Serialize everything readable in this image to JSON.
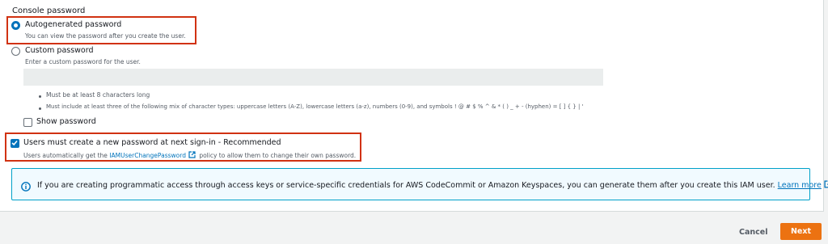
{
  "console_password": {
    "section_label": "Console password",
    "autogenerated": {
      "label": "Autogenerated password",
      "description": "You can view the password after you create the user.",
      "selected": true
    },
    "custom": {
      "label": "Custom password",
      "description": "Enter a custom password for the user.",
      "input_value": "",
      "rules": [
        "Must be at least 8 characters long",
        "Must include at least three of the following mix of character types: uppercase letters (A-Z), lowercase letters (a-z), numbers (0-9), and symbols ! @ # $ % ^ & * ( ) _ + - (hyphen) = [ ] { } | '"
      ]
    },
    "show_password": {
      "label": "Show password",
      "checked": false
    },
    "require_reset": {
      "label": "Users must create a new password at next sign-in - Recommended",
      "description_prefix": "Users automatically get the ",
      "policy_link": "IAMUserChangePassword",
      "description_suffix": " policy to allow them to change their own password.",
      "checked": true
    }
  },
  "info": {
    "text": "If you are creating programmatic access through access keys or service-specific credentials for AWS CodeCommit or Amazon Keyspaces, you can generate them after you create this IAM user.",
    "link": "Learn more"
  },
  "footer": {
    "cancel_label": "Cancel",
    "next_label": "Next"
  },
  "colors": {
    "accent": "#0073bb",
    "primary_button": "#ec7211",
    "highlight": "#d13212",
    "info_border": "#00a1c9"
  }
}
